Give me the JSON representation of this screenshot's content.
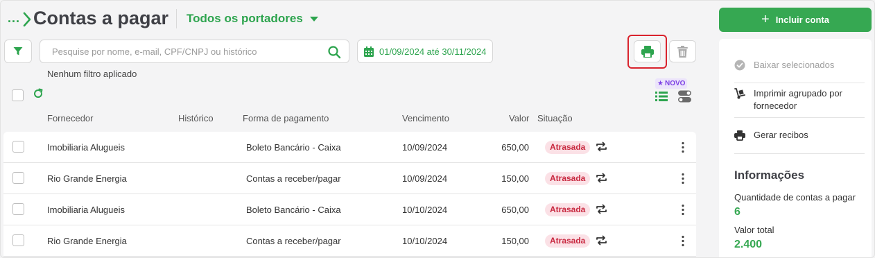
{
  "header": {
    "breadcrumb_dots": "...",
    "title": "Contas a pagar",
    "portador_label": "Todos os portadores"
  },
  "toolbar": {
    "search_placeholder": "Pesquise por nome, e-mail, CPF/CNPJ ou histórico",
    "search_value": "",
    "date_range": "01/09/2024 até 30/11/2024",
    "filter_status": "Nenhum filtro aplicado",
    "novo_badge": "NOVO"
  },
  "table": {
    "columns": {
      "fornecedor": "Fornecedor",
      "historico": "Histórico",
      "forma": "Forma de pagamento",
      "vencimento": "Vencimento",
      "valor": "Valor",
      "situacao": "Situação"
    },
    "rows": [
      {
        "fornecedor": "Imobiliaria Alugueis",
        "historico": "",
        "forma": "Boleto Bancário - Caixa",
        "vencimento": "10/09/2024",
        "valor": "650,00",
        "situacao": "Atrasada"
      },
      {
        "fornecedor": "Rio Grande Energia",
        "historico": "",
        "forma": "Contas a receber/pagar",
        "vencimento": "10/09/2024",
        "valor": "150,00",
        "situacao": "Atrasada"
      },
      {
        "fornecedor": "Imobiliaria Alugueis",
        "historico": "",
        "forma": "Boleto Bancário - Caixa",
        "vencimento": "10/10/2024",
        "valor": "650,00",
        "situacao": "Atrasada"
      },
      {
        "fornecedor": "Rio Grande Energia",
        "historico": "",
        "forma": "Contas a receber/pagar",
        "vencimento": "10/10/2024",
        "valor": "150,00",
        "situacao": "Atrasada"
      }
    ]
  },
  "side": {
    "include_label": "Incluir conta",
    "actions": {
      "baixar": "Baixar selecionados",
      "imprimir": "Imprimir agrupado por fornecedor",
      "recibos": "Gerar recibos"
    },
    "info": {
      "title": "Informações",
      "qtd_label": "Quantidade de contas a pagar",
      "qtd_value": "6",
      "total_label": "Valor total",
      "total_value": "2.400"
    }
  },
  "colors": {
    "accent": "#36a852",
    "status_overdue_bg": "#fbe1e6",
    "status_overdue_text": "#c8283f",
    "highlight": "#d9232d",
    "novo": "#7b3fe4"
  }
}
